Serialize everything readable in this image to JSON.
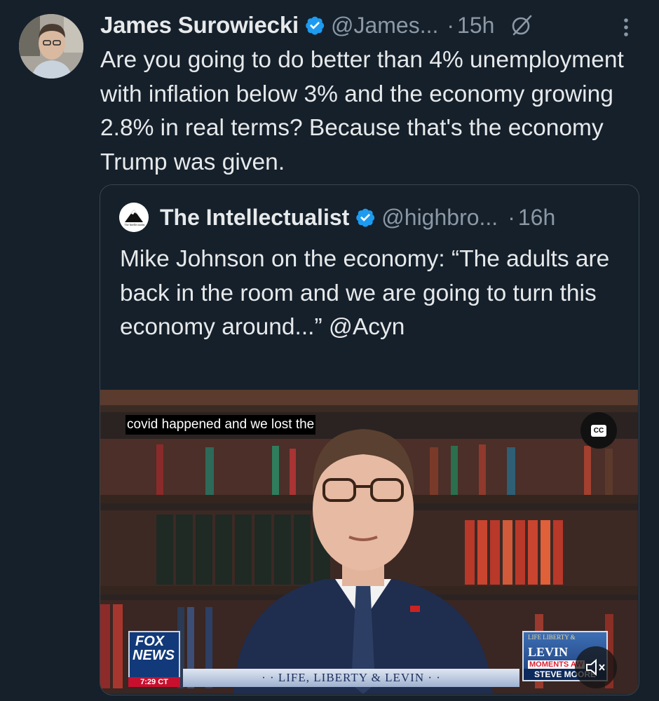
{
  "author": {
    "display_name": "James Surowiecki",
    "handle": "@James...",
    "time": "15h",
    "separator": "·"
  },
  "tweet_text": "Are you going to do better than 4% unemployment with inflation below 3% and the economy growing 2.8% in real terms? Because that's the economy Trump was given.",
  "quoted": {
    "display_name": "The Intellectualist",
    "handle": "@highbro...",
    "time": "16h",
    "separator": "·",
    "avatar_text": "The Intellectualist",
    "text": "Mike Johnson on the economy: “The adults are back in the room and we are going to turn this economy around...” @Acyn",
    "video": {
      "caption": "covid happened and we lost the",
      "cc_label": "CC",
      "network": "FOX",
      "network_sub": "NEWS",
      "clock": "7:29 CT",
      "show_title": "· · LIFE, LIBERTY & LEVIN · ·",
      "panel_top": "LIFE LIBERTY &",
      "panel_name": "LEVIN",
      "panel_moments": "MOMENTS AW",
      "panel_guest": "STEVE MOORE"
    }
  },
  "colors": {
    "background": "#15202b",
    "verified": "#1d9bf0",
    "secondary_text": "#8b98a5",
    "border": "#38444d"
  },
  "icons": [
    "verified-icon",
    "grok-icon",
    "more-icon",
    "cc-icon",
    "mute-icon"
  ]
}
